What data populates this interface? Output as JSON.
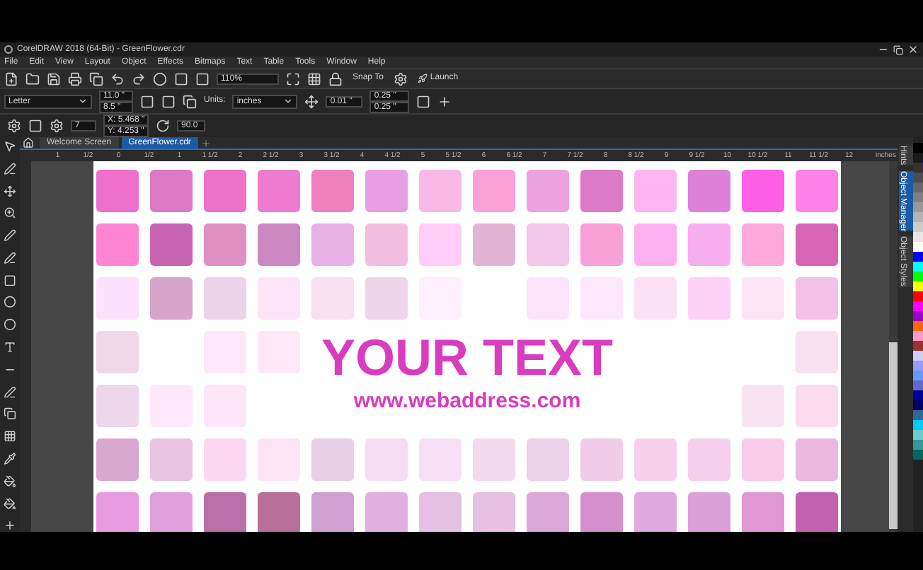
{
  "window": {
    "title": "CorelDRAW 2018 (64-Bit) - GreenFlower.cdr"
  },
  "menu": [
    "File",
    "Edit",
    "View",
    "Layout",
    "Object",
    "Effects",
    "Bitmaps",
    "Text",
    "Table",
    "Tools",
    "Window",
    "Help"
  ],
  "standard_toolbar": {
    "zoom": "110%",
    "snap": "Snap To",
    "launch": "Launch"
  },
  "property_bar": {
    "page_size": "Letter",
    "width": "11.0 \"",
    "height": "8.5 \"",
    "units_label": "Units:",
    "units": "inches",
    "nudge": "0.01 \"",
    "dup_x": "0.25 \"",
    "dup_y": "0.25 \""
  },
  "transform_bar": {
    "count": "7",
    "x": "X: 5.468 \"",
    "y": "Y: 4.253 \"",
    "angle": "90.0"
  },
  "document_tabs": [
    {
      "label": "Welcome Screen",
      "selected": false
    },
    {
      "label": "GreenFlower.cdr",
      "selected": true
    }
  ],
  "ruler": {
    "labels": [
      "1",
      "1/2",
      "0",
      "1/2",
      "1",
      "1 1/2",
      "2",
      "2 1/2",
      "3",
      "3 1/2",
      "4",
      "4 1/2",
      "5",
      "5 1/2",
      "6",
      "6 1/2",
      "7",
      "7 1/2",
      "8",
      "8 1/2",
      "9",
      "9 1/2",
      "10",
      "10 1/2",
      "11",
      "11 1/2",
      "12"
    ],
    "unit": "inches"
  },
  "canvas": {
    "headline": "YOUR TEXT",
    "url": "www.webaddress.com"
  },
  "dockers": [
    {
      "label": "Hints",
      "selected": false
    },
    {
      "label": "Object Manager",
      "selected": true
    },
    {
      "label": "Object Styles",
      "selected": false
    }
  ]
}
